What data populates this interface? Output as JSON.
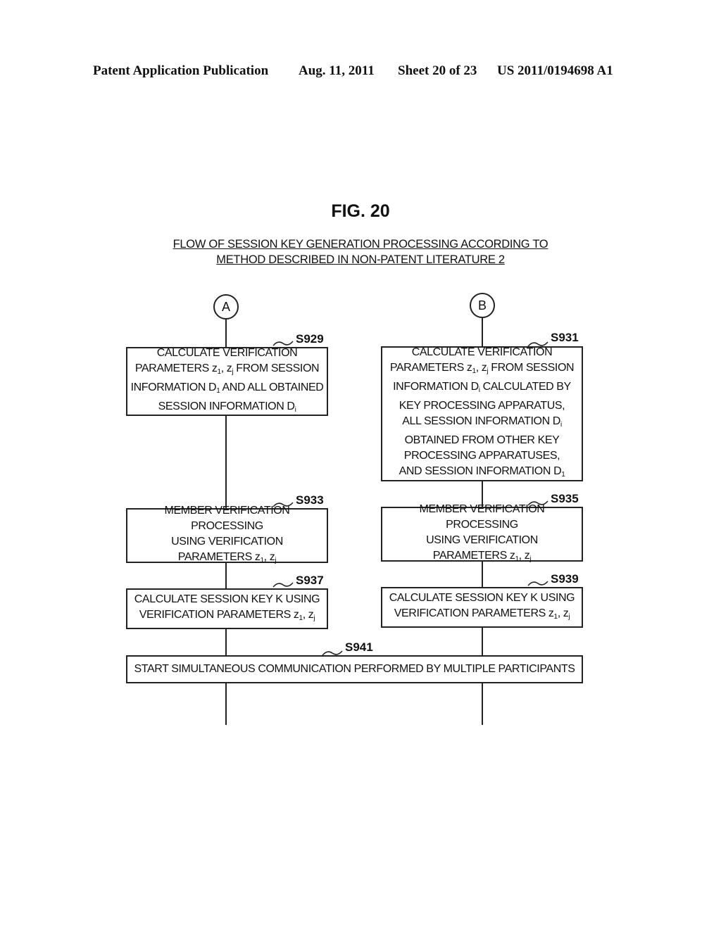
{
  "header": {
    "publication": "Patent Application Publication",
    "date": "Aug. 11, 2011",
    "sheet": "Sheet 20 of 23",
    "number": "US 2011/0194698 A1"
  },
  "figure": {
    "title": "FIG. 20",
    "subtitle_line1": "FLOW OF SESSION KEY GENERATION PROCESSING ACCORDING TO",
    "subtitle_line2": "METHOD DESCRIBED IN NON-PATENT LITERATURE 2"
  },
  "connectors": {
    "left": "A",
    "right": "B"
  },
  "steps": {
    "s929": {
      "label": "S929",
      "lines": [
        "CALCULATE VERIFICATION",
        "PARAMETERS z1, zj FROM SESSION",
        "INFORMATION D1 AND ALL OBTAINED",
        "SESSION INFORMATION Di"
      ]
    },
    "s931": {
      "label": "S931",
      "lines": [
        "CALCULATE VERIFICATION",
        "PARAMETERS z1, zj FROM SESSION",
        "INFORMATION Di CALCULATED BY",
        "KEY PROCESSING APPARATUS,",
        "ALL SESSION INFORMATION Di",
        "OBTAINED FROM OTHER KEY",
        "PROCESSING APPARATUSES,",
        "AND SESSION INFORMATION D1"
      ]
    },
    "s933": {
      "label": "S933",
      "lines": [
        "MEMBER VERIFICATION PROCESSING",
        "USING VERIFICATION",
        "PARAMETERS z1, zj"
      ]
    },
    "s935": {
      "label": "S935",
      "lines": [
        "MEMBER VERIFICATION PROCESSING",
        "USING VERIFICATION",
        "PARAMETERS z1, zj"
      ]
    },
    "s937": {
      "label": "S937",
      "lines": [
        "CALCULATE SESSION KEY K USING",
        "VERIFICATION PARAMETERS z1, zj"
      ]
    },
    "s939": {
      "label": "S939",
      "lines": [
        "CALCULATE SESSION KEY K USING",
        "VERIFICATION PARAMETERS z1, zj"
      ]
    },
    "s941": {
      "label": "S941",
      "lines": [
        "START SIMULTANEOUS COMMUNICATION PERFORMED BY MULTIPLE PARTICIPANTS"
      ]
    }
  }
}
